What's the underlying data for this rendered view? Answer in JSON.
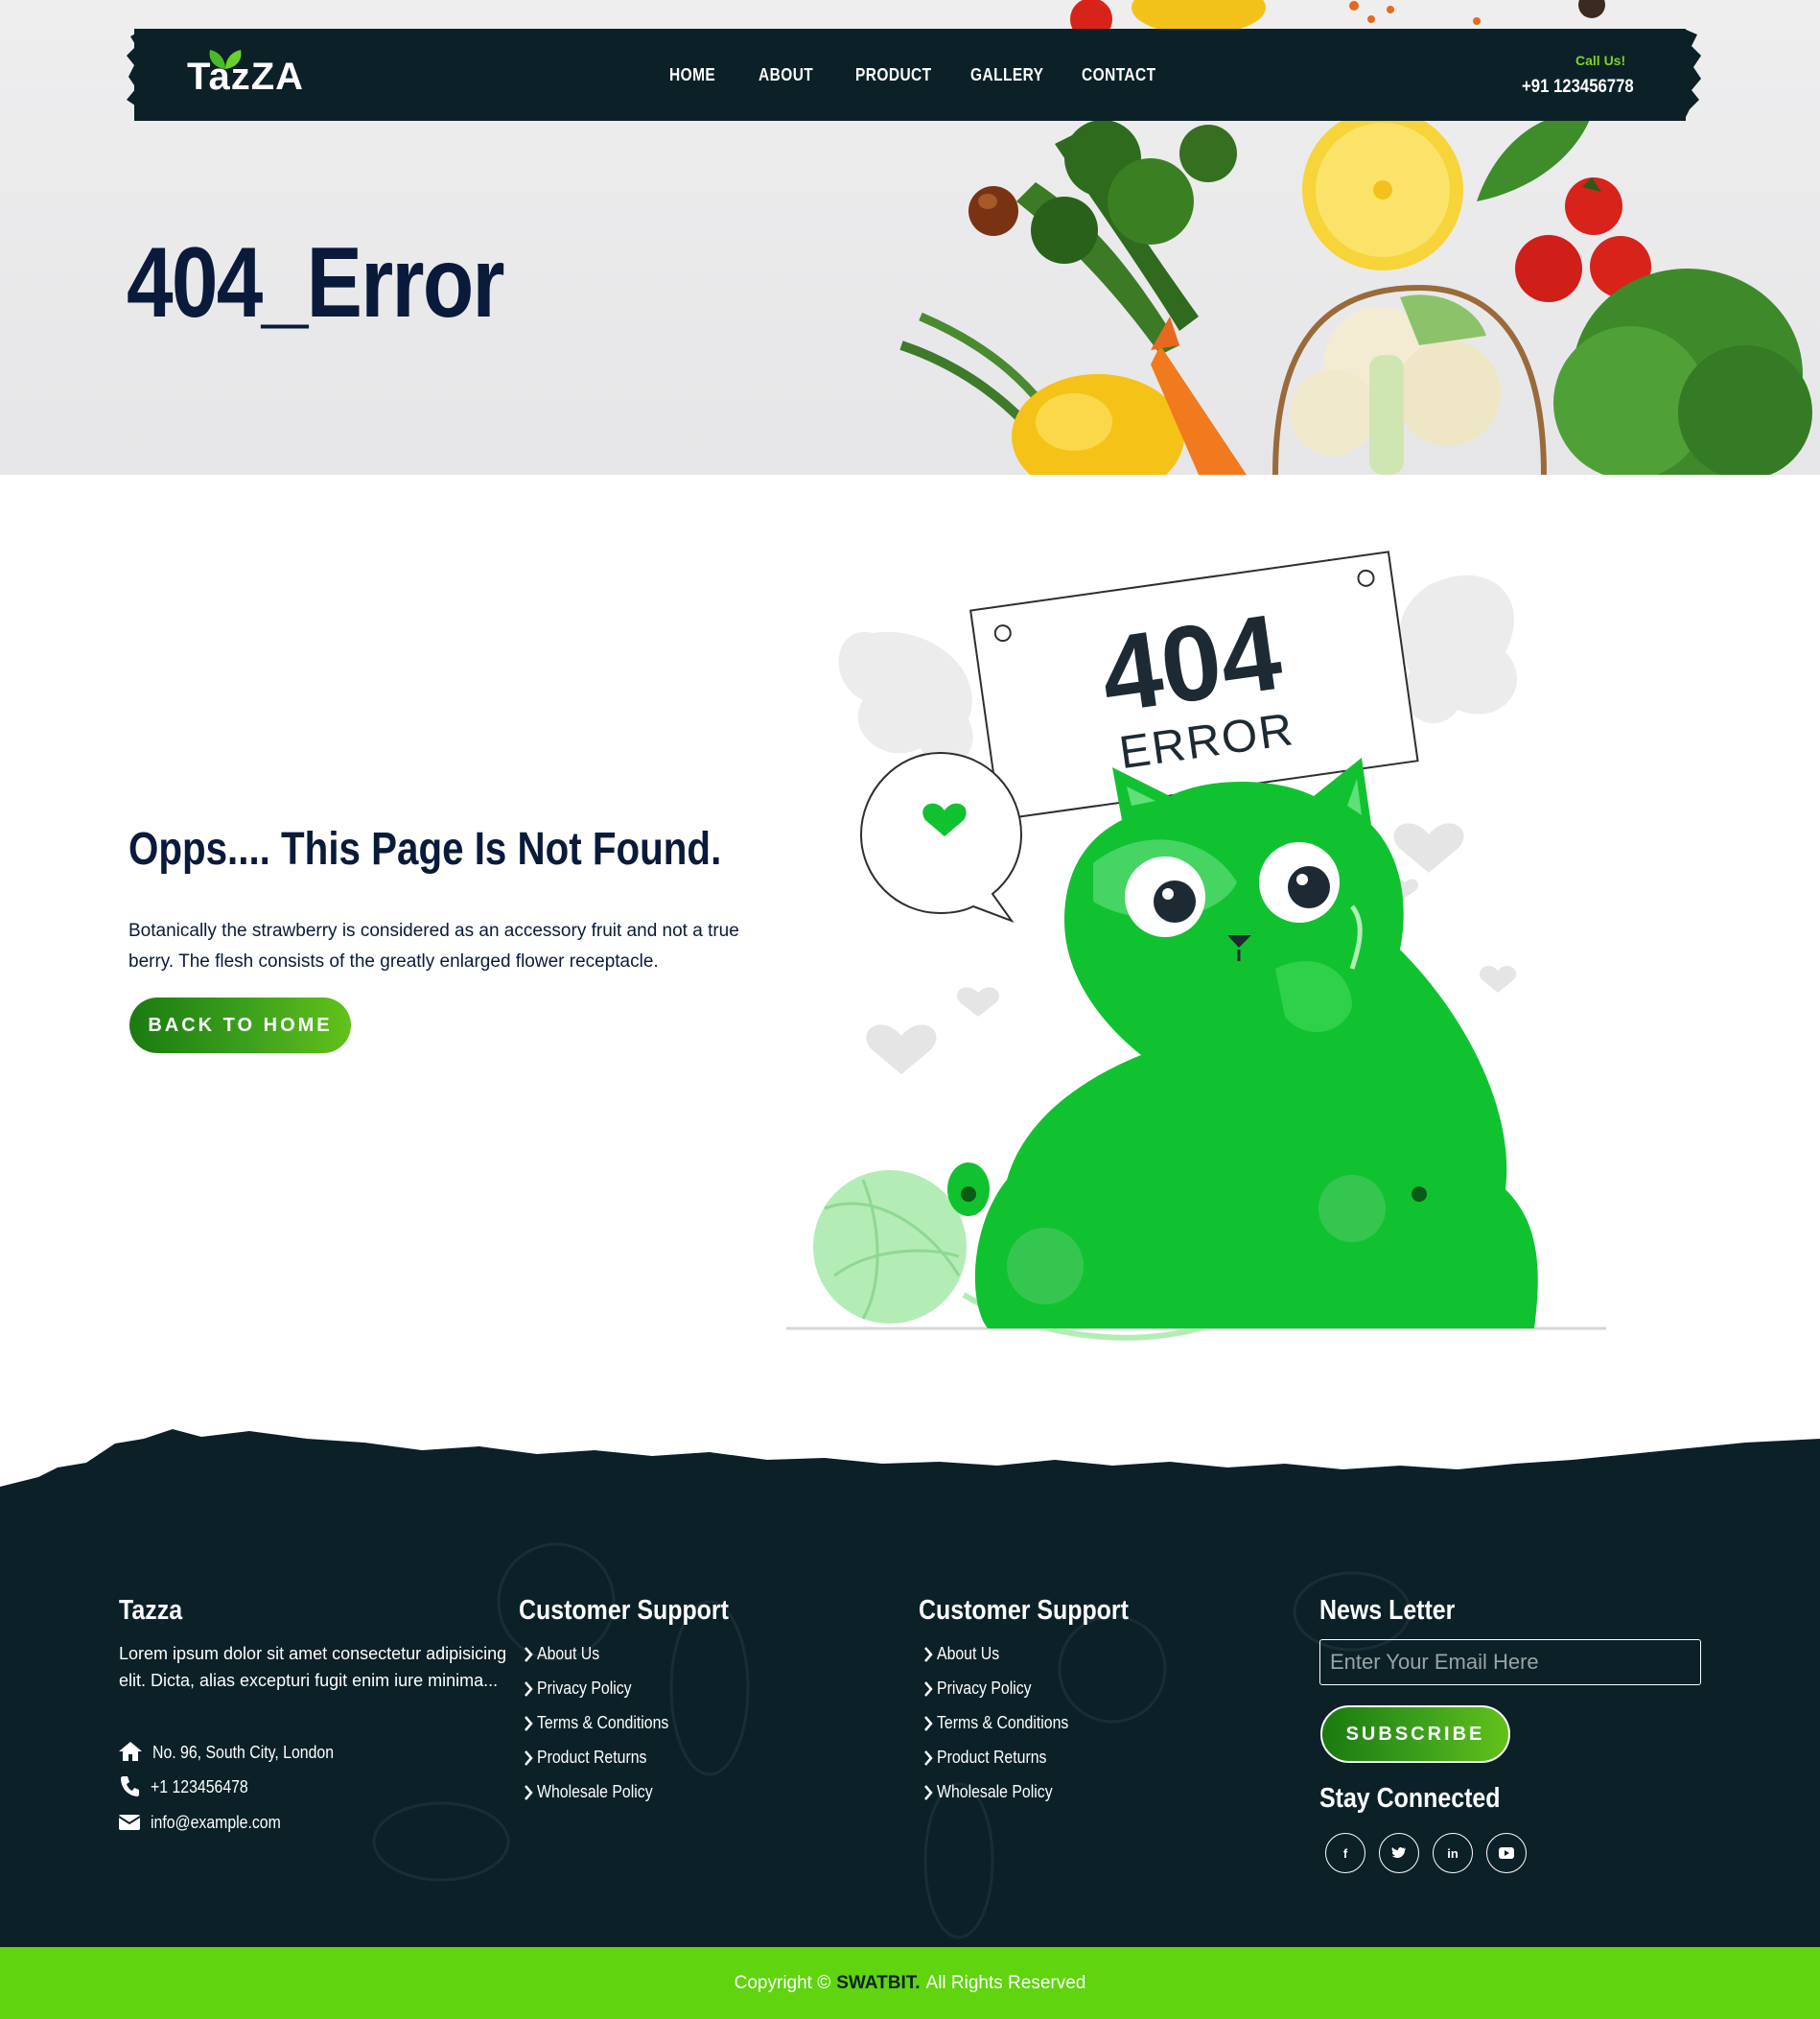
{
  "header": {
    "logo": "TazZA",
    "nav": [
      "HOME",
      "ABOUT",
      "PRODUCT",
      "GALLERY",
      "CONTACT"
    ],
    "call_label": "Call Us!",
    "call_number": "+91 123456778"
  },
  "hero": {
    "title": "404_Error"
  },
  "main": {
    "heading": "Opps.... This Page Is Not Found.",
    "text": "Botanically the strawberry is considered as an accessory fruit and not a true berry. The flesh consists of the greatly enlarged flower receptacle.",
    "button": "BACK TO HOME",
    "illustration": {
      "code": "404",
      "word": "ERROR"
    }
  },
  "footer": {
    "about": {
      "title": "Tazza",
      "text": "Lorem ipsum dolor sit amet consectetur adipisicing elit. Dicta, alias excepturi fugit enim iure minima...",
      "address": "No. 96, South City, London",
      "phone": "+1 123456478",
      "email": "info@example.com"
    },
    "col2": {
      "title": "Customer Support",
      "links": [
        "About Us",
        "Privacy Policy",
        "Terms & Conditions",
        "Product Returns",
        "Wholesale Policy"
      ]
    },
    "col3": {
      "title": "Customer Support",
      "links": [
        "About Us",
        "Privacy Policy",
        "Terms & Conditions",
        "Product Returns",
        "Wholesale Policy"
      ]
    },
    "newsletter": {
      "title": "News Letter",
      "placeholder": "Enter Your Email Here",
      "button": "SUBSCRIBE",
      "stay_title": "Stay Connected",
      "social": [
        "f",
        "t",
        "in",
        "yt"
      ]
    },
    "copyright": {
      "prefix": "Copyright ©",
      "brand": "SWATBIT.",
      "suffix": "All Rights Reserved"
    }
  },
  "colors": {
    "dark": "#0b2027",
    "accent": "#5fd40f",
    "green": "#11c230",
    "navy": "#0a1a3a"
  }
}
